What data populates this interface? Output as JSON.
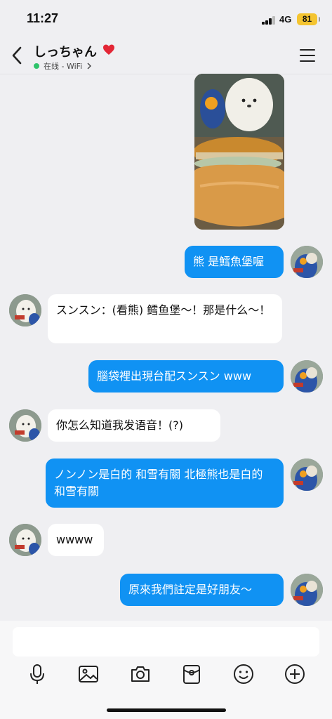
{
  "status": {
    "time": "11:27",
    "network": "4G",
    "battery": "81"
  },
  "header": {
    "title": "しっちゃん",
    "presence": "在线 - WiFi"
  },
  "messages": [
    {
      "dir": "out",
      "text": "熊 是鱈魚堡喔"
    },
    {
      "dir": "in",
      "text": "スンスン：(看熊) 鳕鱼堡～！那是什么～！"
    },
    {
      "dir": "out",
      "text": "腦袋裡出現台配スンスン www"
    },
    {
      "dir": "in",
      "text": "你怎么知道我发语音！(?)"
    },
    {
      "dir": "out",
      "text": "ノンノン是白的 和雪有關 北極熊也是白的 和雪有關"
    },
    {
      "dir": "in",
      "text": "wwww"
    },
    {
      "dir": "out",
      "text": "原來我們註定是好朋友～"
    }
  ],
  "composer": {
    "placeholder": ""
  },
  "toolbar": [
    "microphone-icon",
    "image-icon",
    "camera-icon",
    "red-packet-icon",
    "emoji-icon",
    "plus-icon"
  ],
  "colors": {
    "outgoing_bubble": "#1092f3",
    "incoming_bubble": "#ffffff",
    "background": "#efeff2",
    "online": "#2fc36b",
    "battery": "#f4c430"
  }
}
